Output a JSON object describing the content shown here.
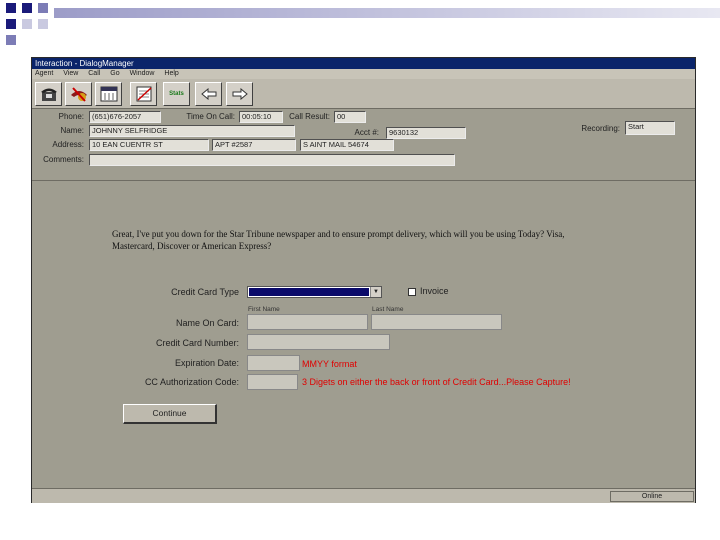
{
  "window": {
    "title": "Interaction - DialogManager"
  },
  "menu": [
    "Agent",
    "View",
    "Call",
    "Go",
    "Window",
    "Help"
  ],
  "toolbar": {
    "stats_label": "Stats"
  },
  "header": {
    "phone_label": "Phone:",
    "phone_value": "(651)676-2057",
    "time_label": "Time On Call:",
    "time_value": "00:05:10",
    "call_result_label": "Call Result:",
    "call_result_value": "00",
    "name_label": "Name:",
    "name_value": "JOHNNY SELFRIDGE",
    "acct_label": "Acct #:",
    "acct_value": "9630132",
    "recording_label": "Recording:",
    "recording_value": "Start",
    "address_label": "Address:",
    "address_value": "10 EAN CUENTR ST",
    "apt_value": "APT #2587",
    "city_value": "S AINT MAIL  54674",
    "comments_label": "Comments:",
    "comments_value": ""
  },
  "script": {
    "text": "Great, I've put you down for the Star Tribune newspaper and to ensure prompt delivery, which will you be using Today? Visa, Mastercard, Discover or American Express?"
  },
  "form": {
    "cc_type_label": "Credit Card Type",
    "invoice_label": "Invoice",
    "first_name_label": "First Name",
    "last_name_label": "Last Name",
    "name_on_card_label": "Name On Card:",
    "cc_number_label": "Credit Card Number:",
    "expiration_label": "Expiration Date:",
    "expiration_note": "MMYY format",
    "auth_label": "CC Authorization Code:",
    "auth_note": "3 Digets on either the back or front of Credit Card...Please Capture!",
    "continue_label": "Continue"
  },
  "status": {
    "text": "Online"
  },
  "colors": {
    "title_bar": "#0a246a",
    "window_bg": "#9f9d90",
    "note_red": "#e00000"
  }
}
